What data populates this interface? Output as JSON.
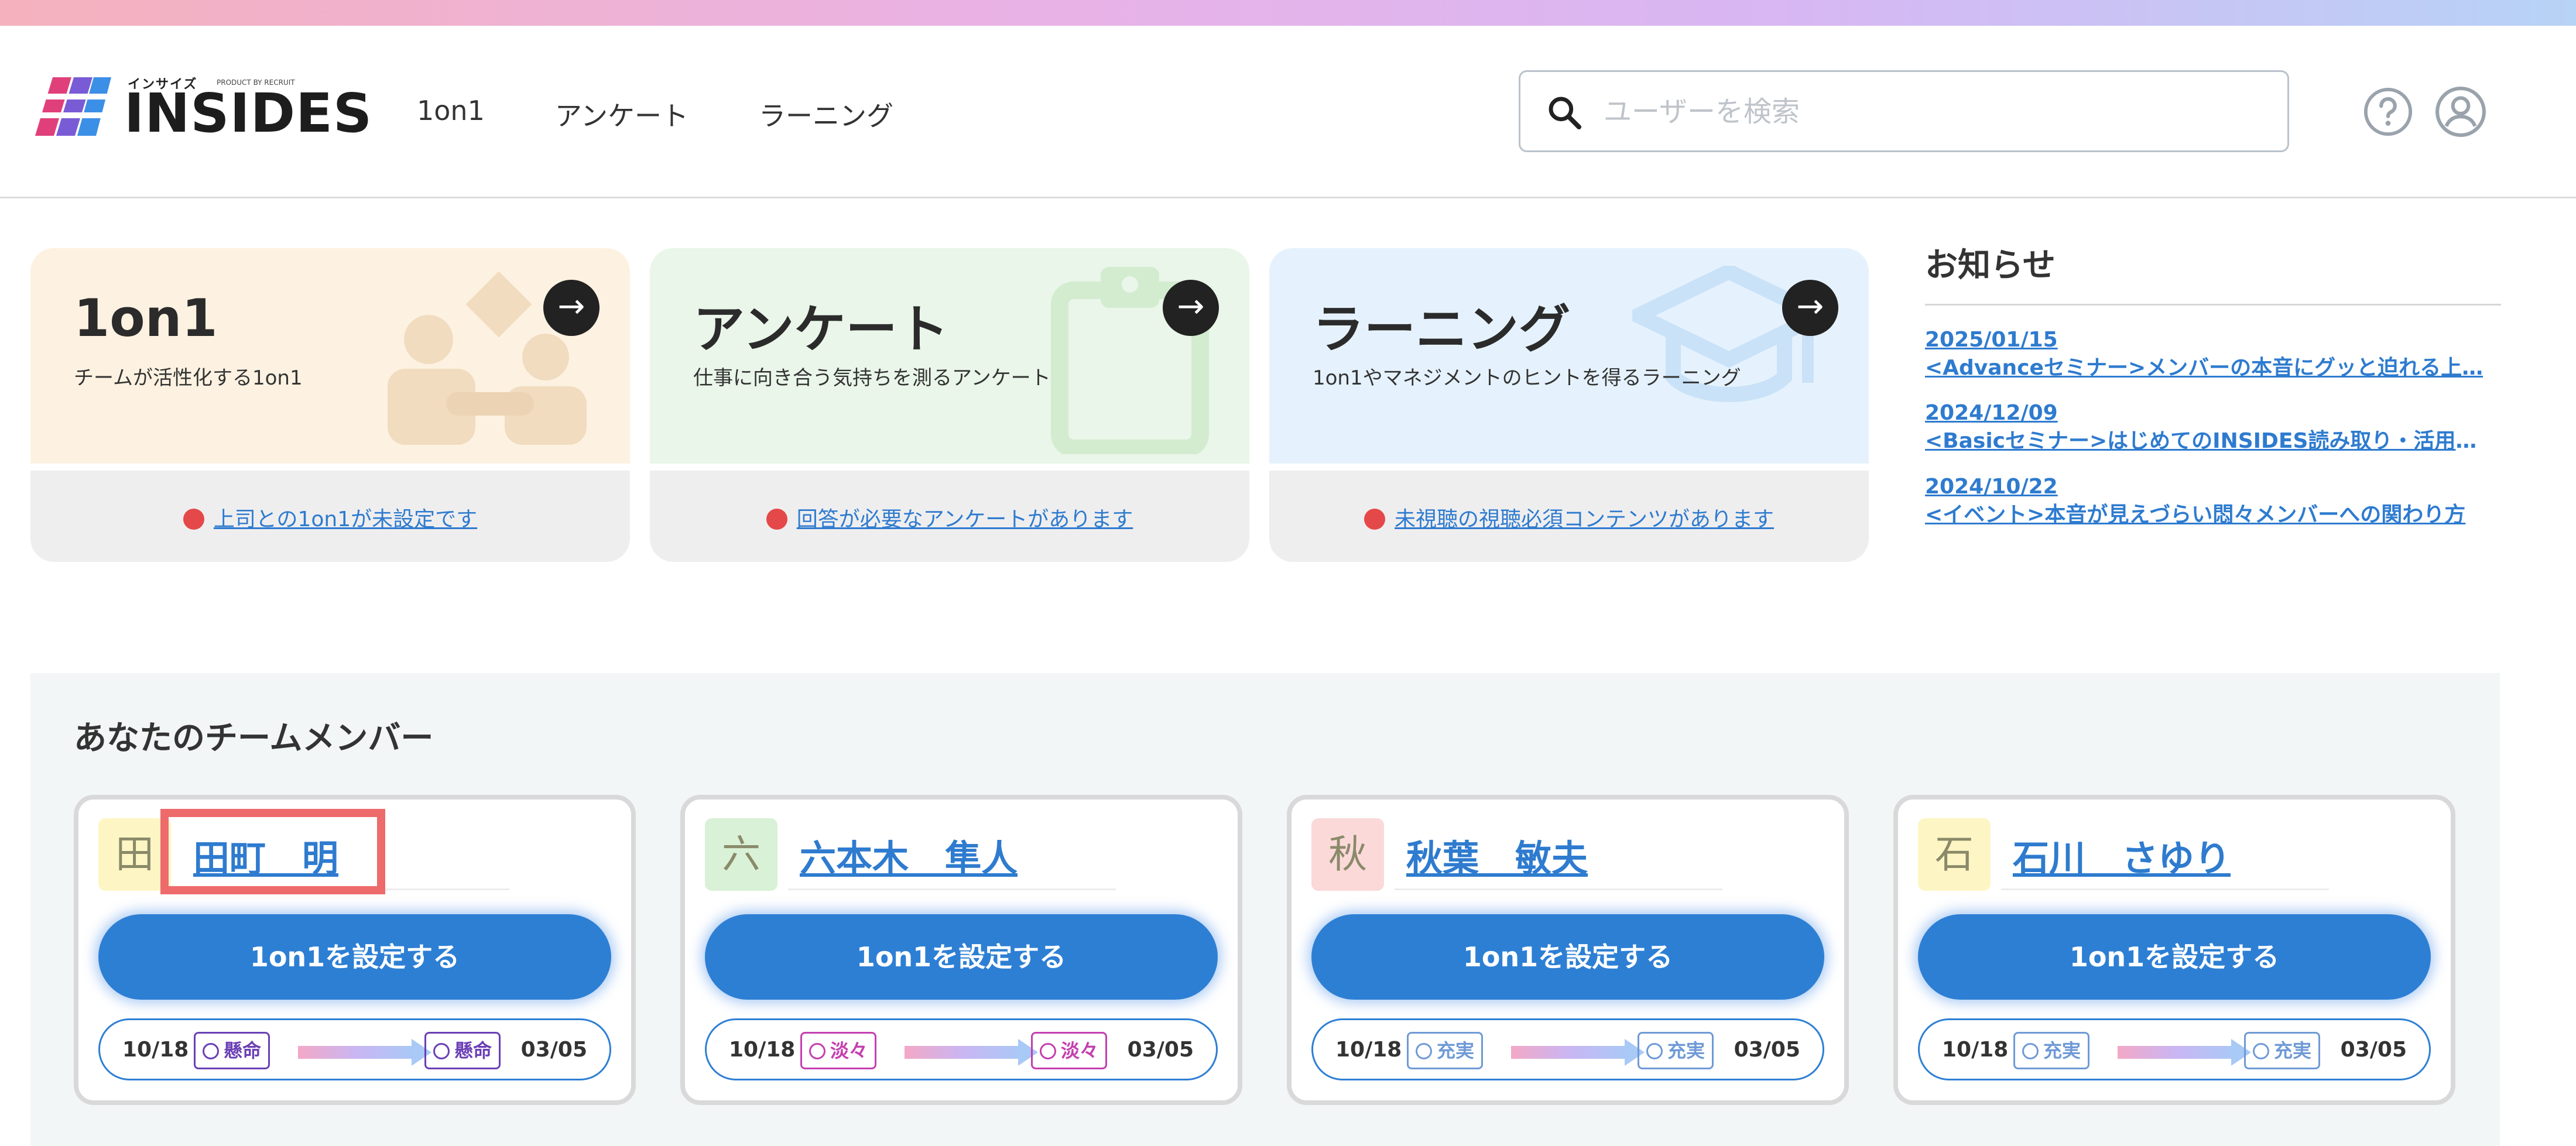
{
  "header": {
    "logo_kana": "インサイズ",
    "logo_sub": "PRODUCT BY RECRUIT",
    "logo_word": "INSIDES",
    "nav": [
      "1on1",
      "アンケート",
      "ラーニング"
    ],
    "search_placeholder": "ユーザーを検索"
  },
  "features": [
    {
      "title": "1on1",
      "desc": "チームが活性化する1on1",
      "notice": "上司との1on1が未設定です",
      "color": "#fdf2e1"
    },
    {
      "title": "アンケート",
      "desc": "仕事に向き合う気持ちを測るアンケート",
      "notice": "回答が必要なアンケートがあります",
      "color": "#e9f6e9"
    },
    {
      "title": "ラーニング",
      "desc": "1on1やマネジメントのヒントを得るラーニング",
      "notice": "未視聴の視聴必須コンテンツがあります",
      "color": "#e5f2fd"
    }
  ],
  "news": {
    "title": "お知らせ",
    "items": [
      {
        "date": "2025/01/15",
        "text": "<Advanceセミナー>メンバーの本音にグッと迫れる上…"
      },
      {
        "date": "2024/12/09",
        "text": "<Basicセミナー>はじめてのINSIDES読み取り・活用セ…"
      },
      {
        "date": "2024/10/22",
        "text": "<イベント>本音が見えづらい悶々メンバーへの関わり方"
      }
    ]
  },
  "team": {
    "title": "あなたのチームメンバー",
    "cta_label": "1on1を設定する",
    "members": [
      {
        "initial": "田",
        "name": "田町　明",
        "initial_bg": "#fdf6c4",
        "date_from": "10/18",
        "date_to": "03/05",
        "status_from": "懸命",
        "status_to": "懸命",
        "status_color": "#6a3fb5"
      },
      {
        "initial": "六",
        "name": "六本木　隼人",
        "initial_bg": "#d9f1d6",
        "date_from": "10/18",
        "date_to": "03/05",
        "status_from": "淡々",
        "status_to": "淡々",
        "status_color": "#c43fb0"
      },
      {
        "initial": "秋",
        "name": "秋葉　敏夫",
        "initial_bg": "#fbd9d9",
        "date_from": "10/18",
        "date_to": "03/05",
        "status_from": "充実",
        "status_to": "充実",
        "status_color": "#6f9ad6"
      },
      {
        "initial": "石",
        "name": "石川　さゆり",
        "initial_bg": "#fdf6c4",
        "date_from": "10/18",
        "date_to": "03/05",
        "status_from": "充実",
        "status_to": "充実",
        "status_color": "#6f9ad6"
      }
    ]
  }
}
